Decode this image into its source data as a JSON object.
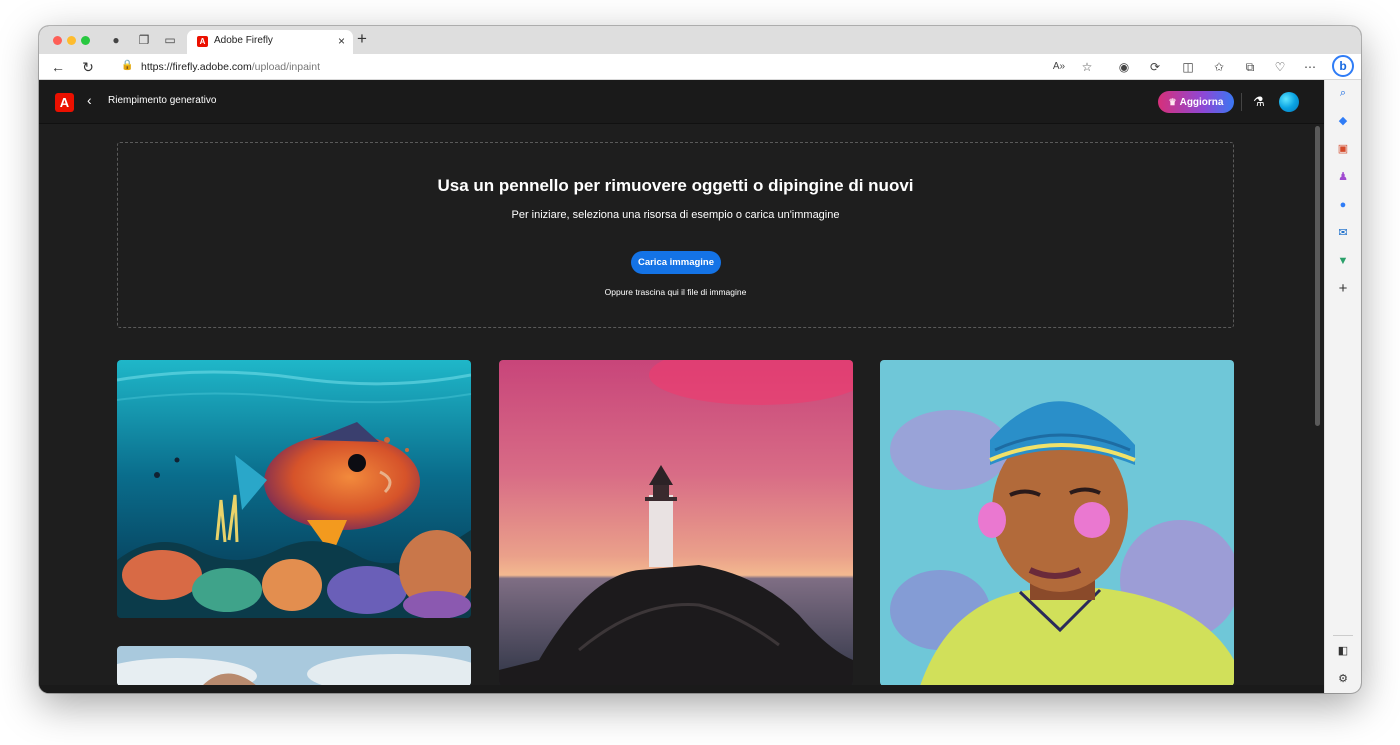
{
  "browser": {
    "tab_title": "Adobe Firefly",
    "tab_close": "×",
    "new_tab": "+",
    "url_host": "https://firefly.adobe.com",
    "url_path": "/upload/inpaint",
    "bing_label": "b"
  },
  "header": {
    "feature_title": "Riempimento generativo",
    "upgrade_label": "Aggiorna"
  },
  "dropzone": {
    "heading": "Usa un pennello per rimuovere oggetti o dipingine di nuovi",
    "subheading": "Per iniziare, seleziona una risorsa di esempio o carica un'immagine",
    "upload_button": "Carica immagine",
    "drag_hint": "Oppure trascina qui il file di immagine"
  },
  "samples": [
    {
      "subject": "underwater coral reef with orange fish"
    },
    {
      "subject": "lighthouse on rock at pink sunset"
    },
    {
      "subject": "illustrated portrait of young man in blue beanie"
    },
    {
      "subject": "sky with clouds (partially visible)"
    }
  ],
  "colors": {
    "app_background": "#1e1e1e",
    "adobe_red": "#eb1000",
    "primary_button": "#1473e6",
    "upgrade_gradient_start": "#d6307a",
    "upgrade_gradient_end": "#3a77f2"
  }
}
